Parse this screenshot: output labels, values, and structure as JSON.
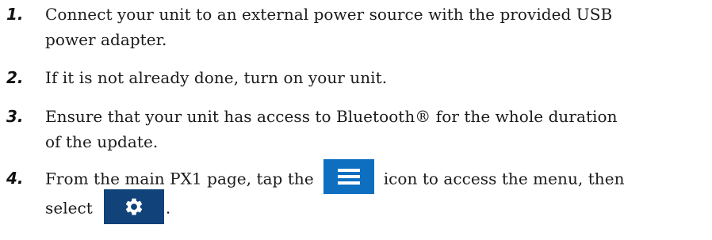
{
  "steps": [
    {
      "number": "1.",
      "lines": [
        "Connect your unit to an external power source with the provided USB",
        "power adapter."
      ]
    },
    {
      "number": "2.",
      "lines": [
        "If it is not already done, turn on your unit."
      ]
    },
    {
      "number": "3.",
      "lines": [
        "Ensure that your unit has access to Bluetooth® for the whole duration",
        "of the update."
      ]
    },
    {
      "number": "4.",
      "before_icon": "From the main PX1 page, tap the",
      "after_icon": "icon to access the menu, then",
      "select_label": "select",
      "end_punct": "."
    }
  ],
  "icons": {
    "menu_icon": "hamburger-menu-icon",
    "settings_icon": "gear-icon",
    "menu_bg": "#0e6fc1",
    "settings_bg": "#11427a"
  }
}
